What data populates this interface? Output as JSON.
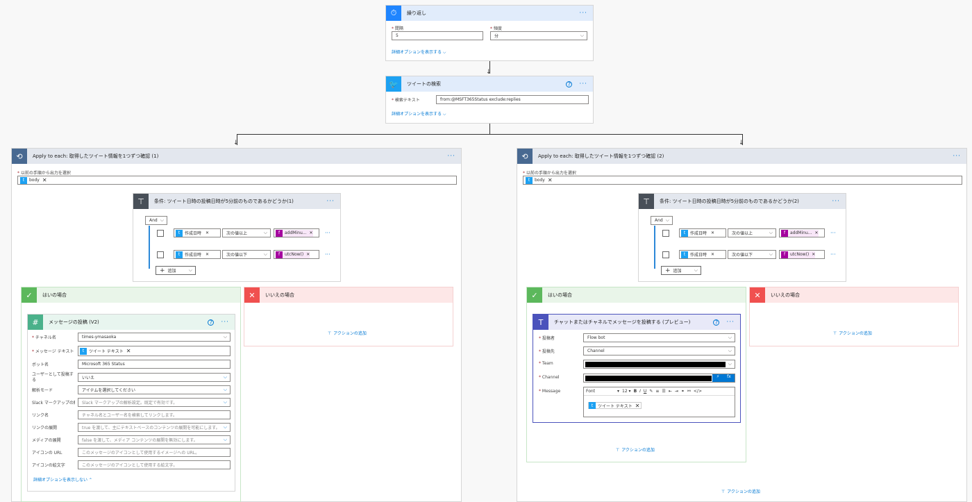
{
  "recurrence": {
    "title": "繰り返し",
    "interval_label": "間隔",
    "interval_value": "5",
    "frequency_label": "頻度",
    "frequency_value": "分",
    "advanced_link": "詳細オプションを表示する"
  },
  "search": {
    "title": "ツイートの検索",
    "text_label": "検索テキスト",
    "text_value": "from:@MSFT365Status exclude:replies",
    "advanced_link": "詳細オプションを表示する"
  },
  "loop1": {
    "title": "Apply to each: 取得したツイート情報を1つずつ確認 (1)",
    "select_label": "以前の手順から出力を選択",
    "token": "body",
    "condition_title": "条件: ツイート日時の投稿日時が5分前のものであるかどうか(1)",
    "and_label": "And",
    "row1_token": "作成日時",
    "row1_op": "次の値以上",
    "row1_expr": "addMinu...",
    "row2_token": "作成日時",
    "row2_op": "次の値以下",
    "row2_expr": "utcNow()",
    "add_label": "追加",
    "yes_title": "はいの場合",
    "no_title": "いいえの場合",
    "no_add_action": "アクションの追加",
    "slack": {
      "title": "メッセージの投稿 (V2)",
      "channel_label": "チャネル名",
      "channel_value": "times-ymasaoka",
      "text_label": "メッセージ テキスト",
      "text_token": "ツイート テキスト",
      "bot_label": "ボット名",
      "bot_value": "Microsoft 365 Status",
      "asuser_label": "ユーザーとして投稿する",
      "asuser_value": "いいえ",
      "parse_label": "解析モード",
      "parse_value": "アイテムを選択してください",
      "mrkdwn_label": "Slack マークアップの解析",
      "mrkdwn_value": "Slack マークアップの解析設定。既定で有効です。",
      "linknames_label": "リンク名",
      "linknames_value": "チャネル名とユーザー名を検索してリンクします。",
      "unfurl_links_label": "リンクの展開",
      "unfurl_links_value": "true を渡して、主にテキストベースのコンテンツの展開を可能にします。",
      "unfurl_media_label": "メディアの展開",
      "unfurl_media_value": "false を渡して、メディア コンテンツの展開を無効にします。",
      "icon_url_label": "アイコンの URL",
      "icon_url_value": "このメッセージのアイコンとして使用するイメージへの URL。",
      "icon_emoji_label": "アイコンの絵文字",
      "icon_emoji_value": "このメッセージのアイコンとして使用する絵文字。",
      "hide_link": "詳細オプションを表示しない"
    }
  },
  "loop2": {
    "title": "Apply to each: 取得したツイート情報を1つずつ確認 (2)",
    "select_label": "以前の手順から出力を選択",
    "token": "body",
    "condition_title": "条件: ツイート日時の投稿日時が5分前のものであるかどうか(2)",
    "and_label": "And",
    "row1_token": "作成日時",
    "row1_op": "次の値以上",
    "row1_expr": "addMinu...",
    "row2_token": "作成日時",
    "row2_op": "次の値以下",
    "row2_expr": "utcNow()",
    "add_label": "追加",
    "yes_title": "はいの場合",
    "no_title": "いいえの場合",
    "no_add_action": "アクションの追加",
    "yes_add_action": "アクションの追加",
    "teams": {
      "title": "チャットまたはチャネルでメッセージを投稿する (プレビュー)",
      "poster_label": "投稿者",
      "poster_value": "Flow bot",
      "postin_label": "投稿先",
      "postin_value": "Channel",
      "team_label": "Team",
      "channel_label": "Channel",
      "message_label": "Message",
      "font_label": "Font",
      "font_size": "12",
      "message_token": "ツイート テキスト"
    }
  },
  "bottom_add_action": "アクションの追加",
  "colors": {
    "accent": "#0078d4",
    "twitter": "#1da1f2",
    "yes": "#5cb85c",
    "no": "#f0504f",
    "expr": "#a4009e",
    "teams": "#4b53bc",
    "slack": "#4ab18a"
  }
}
